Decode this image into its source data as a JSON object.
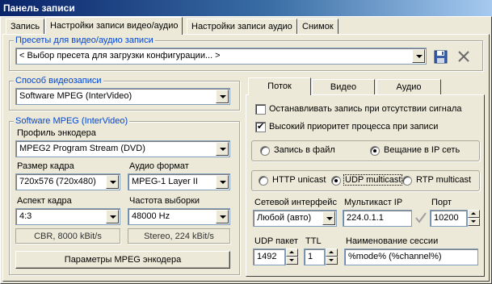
{
  "window": {
    "title": "Панель записи"
  },
  "tabs": [
    "Запись",
    "Настройки записи видео/аудио",
    "Настройки записи аудио",
    "Снимок"
  ],
  "presets": {
    "legend": "Пресеты для видео/аудио записи",
    "selected": "< Выбор пресета для загрузки конфигурации... >",
    "save_icon": "save-icon",
    "delete_icon": "close-icon"
  },
  "capture_method": {
    "legend": "Способ видеозаписи",
    "selected": "Software MPEG (InterVideo)"
  },
  "software_mpeg": {
    "legend": "Software MPEG (InterVideo)",
    "encoder_profile_label": "Профиль энкодера",
    "encoder_profile_value": "MPEG2 Program Stream (DVD)",
    "frame_size_label": "Размер кадра",
    "frame_size_value": "720x576 (720x480)",
    "audio_format_label": "Аудио формат",
    "audio_format_value": "MPEG-1 Layer II",
    "aspect_label": "Аспект кадра",
    "aspect_value": "4:3",
    "sample_rate_label": "Частота выборки",
    "sample_rate_value": "48000 Hz",
    "video_info": "CBR, 8000 kBit/s",
    "audio_info": "Stereo, 224 kBit/s",
    "params_button": "Параметры MPEG энкодера"
  },
  "subtabs": [
    "Поток",
    "Видео",
    "Аудио"
  ],
  "stream": {
    "stop_on_no_signal": {
      "label": "Останавливать запись при отсутствии сигнала",
      "checked": false
    },
    "high_priority": {
      "label": "Высокий приоритет процесса при записи",
      "checked": true
    },
    "mode_file": {
      "label": "Запись в файл",
      "selected": false
    },
    "mode_ip": {
      "label": "Вещание в IP сеть",
      "selected": true
    },
    "proto_http": {
      "label": "HTTP unicast",
      "selected": false
    },
    "proto_udp": {
      "label": "UDP multicast",
      "selected": true
    },
    "proto_rtp": {
      "label": "RTP multicast",
      "selected": false
    },
    "net_iface_label": "Сетевой интерфейс",
    "net_iface_value": "Любой (авто)",
    "multicast_ip_label": "Мультикаст IP",
    "multicast_ip_value": "224.0.1.1",
    "port_label": "Порт",
    "port_value": "10200",
    "udp_packet_label": "UDP пакет",
    "udp_packet_value": "1492",
    "ttl_label": "TTL",
    "ttl_value": "1",
    "session_name_label": "Наименование сессии",
    "session_name_value": "%mode% (%channel%)",
    "check_icon": "checkmark-icon"
  }
}
